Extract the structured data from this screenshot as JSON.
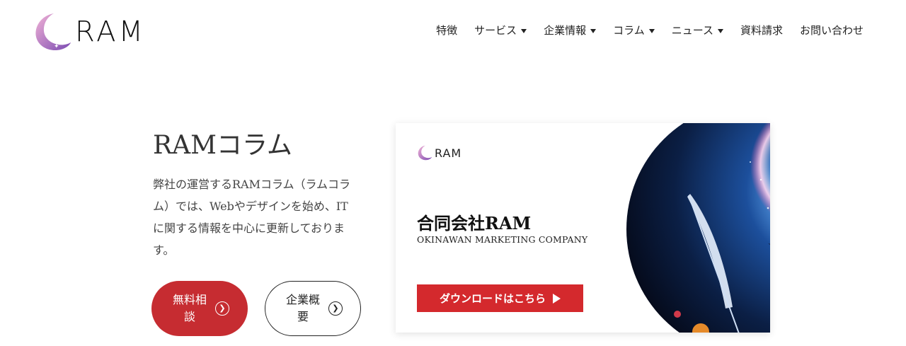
{
  "header": {
    "logo_text": "RAM",
    "nav": [
      {
        "label": "特徴",
        "has_dropdown": false
      },
      {
        "label": "サービス",
        "has_dropdown": true
      },
      {
        "label": "企業情報",
        "has_dropdown": true
      },
      {
        "label": "コラム",
        "has_dropdown": true
      },
      {
        "label": "ニュース",
        "has_dropdown": true
      },
      {
        "label": "資料請求",
        "has_dropdown": false
      },
      {
        "label": "お問い合わせ",
        "has_dropdown": false
      }
    ]
  },
  "hero": {
    "title": "RAMコラム",
    "description": "弊社の運営するRAMコラム（ラムコラム）では、Webやデザインを始め、ITに関する情報を中心に更新しております。",
    "primary_button": "無料相談",
    "secondary_button": "企業概要"
  },
  "banner": {
    "logo_text": "RAM",
    "company_name": "合同会社RAM",
    "tagline": "OKINAWAN MARKETING COMPANY",
    "cta_label": "ダウンロードはこちら"
  },
  "colors": {
    "accent_red": "#c62c31",
    "banner_cta": "#d4292d",
    "logo_gradient_start": "#e08ab8",
    "logo_gradient_end": "#7b4bb2"
  },
  "icons": {
    "logo": "crescent-moon-icon",
    "nav_caret": "caret-down-icon",
    "button_arrow": "circle-chevron-right-icon",
    "cta_arrow": "play-icon"
  }
}
